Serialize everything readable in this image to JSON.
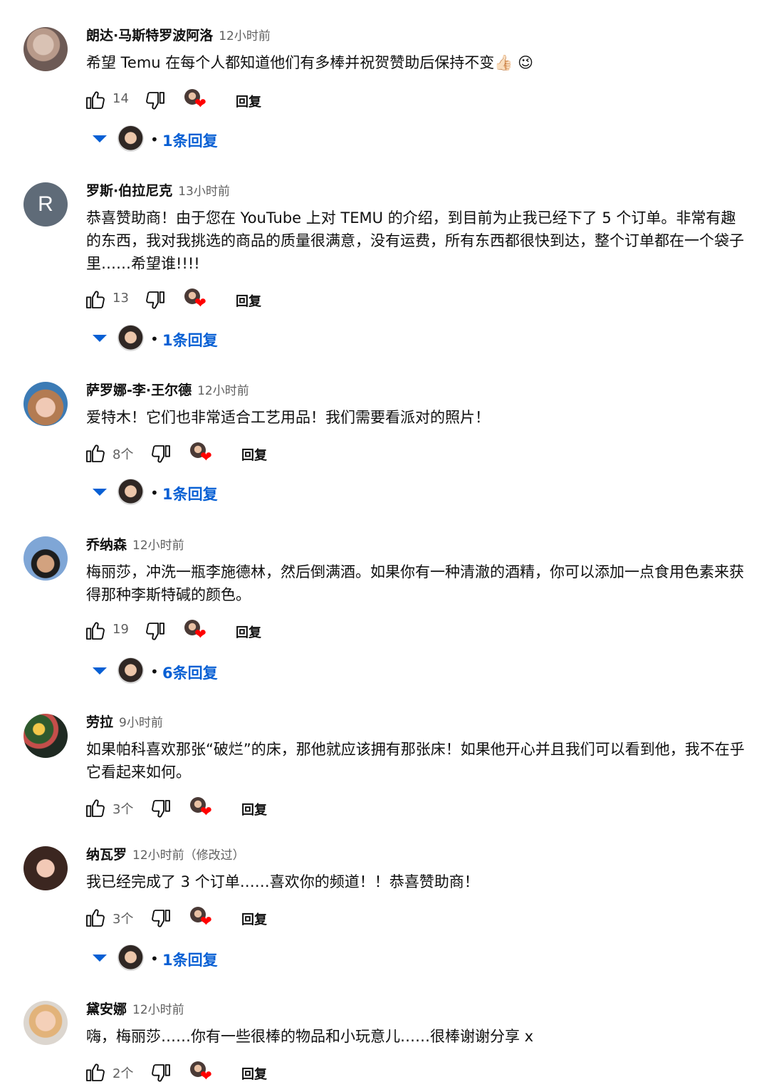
{
  "reply_label": "回复",
  "dot": "•",
  "emoji": "👍🏻 😉",
  "comments": [
    {
      "author": "朗达·马斯特罗波阿洛",
      "time": "12小时前",
      "text": "希望 Temu 在每个人都知道他们有多棒并祝贺赞助后保持不变",
      "likes": "14",
      "replies": "1条回复"
    },
    {
      "author": "罗斯·伯拉尼克",
      "time": "13小时前",
      "avatar_letter": "R",
      "text": "恭喜赞助商！由于您在 YouTube 上对 TEMU 的介绍，到目前为止我已经下了 5 个订单。非常有趣的东西，我对我挑选的商品的质量很满意，没有运费，所有东西都很快到达，整个订单都在一个袋子里……希望谁!!!!",
      "likes": "13",
      "replies": "1条回复"
    },
    {
      "author": "萨罗娜-李·王尔德",
      "time": "12小时前",
      "text": "爱特木！它们也非常适合工艺用品！我们需要看派对的照片！",
      "likes": "8个",
      "replies": "1条回复"
    },
    {
      "author": "乔纳森",
      "time": "12小时前",
      "text": "梅丽莎，冲洗一瓶李施德林，然后倒满酒。如果你有一种清澈的酒精，你可以添加一点食用色素来获得那种李斯特碱的颜色。",
      "likes": "19",
      "replies": "6条回复"
    },
    {
      "author": "劳拉",
      "time": "9小时前",
      "text": "如果帕科喜欢那张“破烂”的床，那他就应该拥有那张床！如果他开心并且我们可以看到他，我不在乎它看起来如何。",
      "likes": "3个"
    },
    {
      "author": "纳瓦罗",
      "time": "12小时前（修改过）",
      "text": "我已经完成了 3 个订单……喜欢你的频道！！恭喜赞助商！",
      "likes": "3个",
      "replies": "1条回复"
    },
    {
      "author": "黛安娜",
      "time": "12小时前",
      "text": "嗨，梅丽莎……你有一些很棒的物品和小玩意儿……很棒谢谢分享 x",
      "likes": "2个"
    }
  ]
}
